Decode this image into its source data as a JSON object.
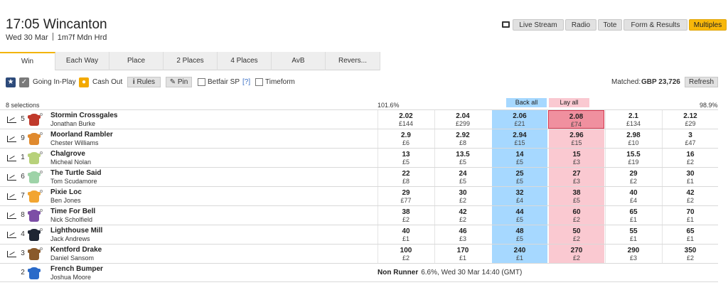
{
  "header": {
    "title": "17:05 Wincanton",
    "date": "Wed 30 Mar",
    "race": "1m7f Mdn Hrd"
  },
  "toolbar": {
    "live_stream": "Live Stream",
    "radio": "Radio",
    "tote": "Tote",
    "form": "Form & Results",
    "multiples": "Multiples"
  },
  "tabs": [
    "Win",
    "Each Way",
    "Place",
    "2 Places",
    "4 Places",
    "AvB",
    "Revers..."
  ],
  "options": {
    "going_in_play": "Going In-Play",
    "cash_out": "Cash Out",
    "rules": "Rules",
    "pin": "Pin",
    "betfair_sp": "Betfair SP",
    "help": "[?]",
    "timeform": "Timeform",
    "matched_label": "Matched:",
    "matched_value": "GBP 23,726",
    "refresh": "Refresh"
  },
  "market": {
    "selections_count": "8 selections",
    "back_overround": "101.6%",
    "lay_overround": "98.9%",
    "back_all": "Back all",
    "lay_all": "Lay all"
  },
  "colors": {
    "back": "#a6d8ff",
    "lay": "#fac9d1",
    "lay_highlight": "#f0909f",
    "accent": "#f8b80a"
  },
  "runners": [
    {
      "number": "5",
      "name": "Stormin Crossgales",
      "jockey": "Jonathan Burke",
      "silk": "#c0392b",
      "prices": [
        {
          "p": "2.02",
          "s": "£144"
        },
        {
          "p": "2.04",
          "s": "£299"
        },
        {
          "p": "2.06",
          "s": "£21"
        },
        {
          "p": "2.08",
          "s": "£74"
        },
        {
          "p": "2.1",
          "s": "£134"
        },
        {
          "p": "2.12",
          "s": "£29"
        }
      ]
    },
    {
      "number": "9",
      "name": "Moorland Rambler",
      "jockey": "Chester Williams",
      "silk": "#e08a2e",
      "prices": [
        {
          "p": "2.9",
          "s": "£6"
        },
        {
          "p": "2.92",
          "s": "£8"
        },
        {
          "p": "2.94",
          "s": "£15"
        },
        {
          "p": "2.96",
          "s": "£15"
        },
        {
          "p": "2.98",
          "s": "£10"
        },
        {
          "p": "3",
          "s": "£47"
        }
      ]
    },
    {
      "number": "1",
      "name": "Chalgrove",
      "jockey": "Micheal Nolan",
      "silk": "#b7d17a",
      "prices": [
        {
          "p": "13",
          "s": "£5"
        },
        {
          "p": "13.5",
          "s": "£5"
        },
        {
          "p": "14",
          "s": "£5"
        },
        {
          "p": "15",
          "s": "£3"
        },
        {
          "p": "15.5",
          "s": "£19"
        },
        {
          "p": "16",
          "s": "£2"
        }
      ]
    },
    {
      "number": "6",
      "name": "The Turtle Said",
      "jockey": "Tom Scudamore",
      "silk": "#9ed3a8",
      "prices": [
        {
          "p": "22",
          "s": "£8"
        },
        {
          "p": "24",
          "s": "£5"
        },
        {
          "p": "25",
          "s": "£5"
        },
        {
          "p": "27",
          "s": "£3"
        },
        {
          "p": "29",
          "s": "£2"
        },
        {
          "p": "30",
          "s": "£1"
        }
      ]
    },
    {
      "number": "7",
      "name": "Pixie Loc",
      "jockey": "Ben Jones",
      "silk": "#f2a531",
      "prices": [
        {
          "p": "29",
          "s": "£77"
        },
        {
          "p": "30",
          "s": "£2"
        },
        {
          "p": "32",
          "s": "£4"
        },
        {
          "p": "38",
          "s": "£5"
        },
        {
          "p": "40",
          "s": "£4"
        },
        {
          "p": "42",
          "s": "£2"
        }
      ]
    },
    {
      "number": "8",
      "name": "Time For Bell",
      "jockey": "Nick Scholfield",
      "silk": "#7d4fa6",
      "prices": [
        {
          "p": "38",
          "s": "£2"
        },
        {
          "p": "42",
          "s": "£2"
        },
        {
          "p": "44",
          "s": "£5"
        },
        {
          "p": "60",
          "s": "£2"
        },
        {
          "p": "65",
          "s": "£1"
        },
        {
          "p": "70",
          "s": "£1"
        }
      ]
    },
    {
      "number": "4",
      "name": "Lighthouse Mill",
      "jockey": "Jack Andrews",
      "silk": "#1f2633",
      "prices": [
        {
          "p": "40",
          "s": "£1"
        },
        {
          "p": "46",
          "s": "£3"
        },
        {
          "p": "48",
          "s": "£5"
        },
        {
          "p": "50",
          "s": "£2"
        },
        {
          "p": "55",
          "s": "£1"
        },
        {
          "p": "65",
          "s": "£1"
        }
      ]
    },
    {
      "number": "3",
      "name": "Kentford Drake",
      "jockey": "Daniel Sansom",
      "silk": "#8a5a2b",
      "prices": [
        {
          "p": "100",
          "s": "£2"
        },
        {
          "p": "170",
          "s": "£1"
        },
        {
          "p": "240",
          "s": "£1"
        },
        {
          "p": "270",
          "s": "£2"
        },
        {
          "p": "290",
          "s": "£3"
        },
        {
          "p": "350",
          "s": "£2"
        }
      ]
    }
  ],
  "non_runner": {
    "number": "2",
    "name": "French Bumper",
    "jockey": "Joshua Moore",
    "silk": "#2a6ac9",
    "label": "Non Runner",
    "info": "6.6%, Wed 30 Mar 14:40 (GMT)"
  }
}
